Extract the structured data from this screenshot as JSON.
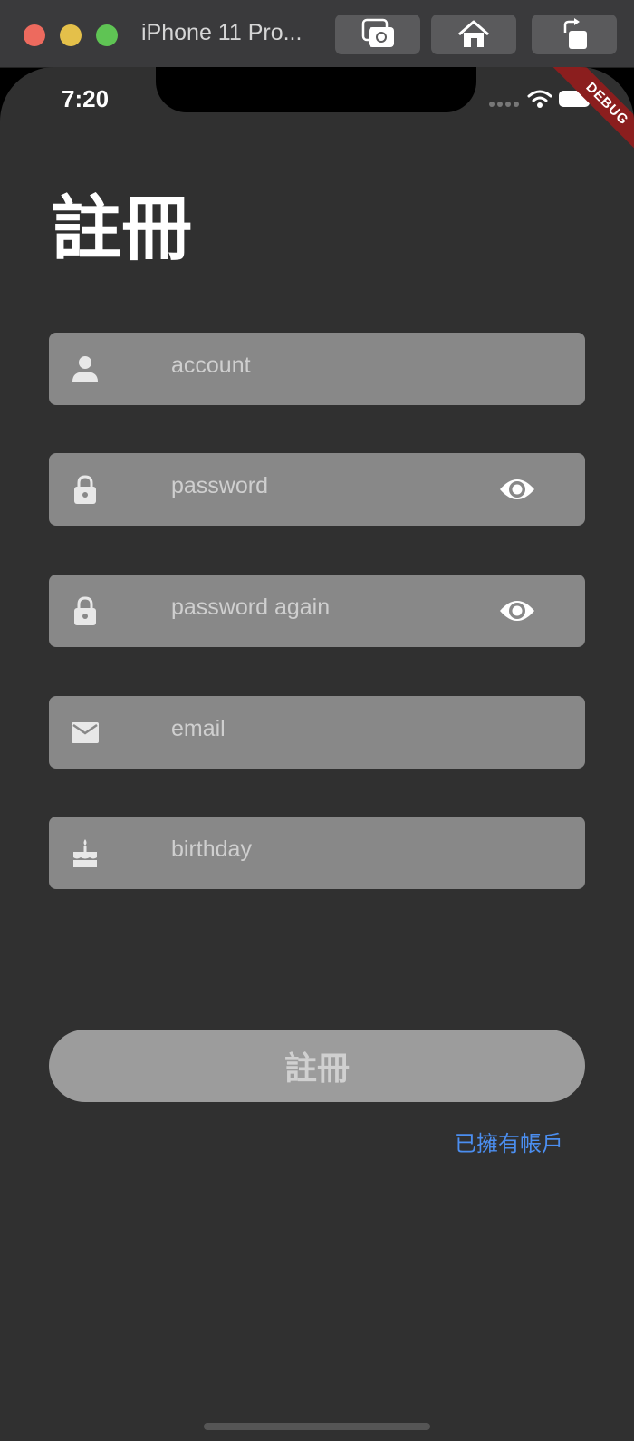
{
  "window": {
    "title": "iPhone 11 Pro..."
  },
  "status_bar": {
    "time": "7:20",
    "debug_label": "DEBUG"
  },
  "page": {
    "title": "註冊"
  },
  "fields": {
    "account": {
      "placeholder": "account",
      "icon": "person-icon"
    },
    "password": {
      "placeholder": "password",
      "icon": "lock-icon"
    },
    "password_again": {
      "placeholder": "password again",
      "icon": "lock-icon"
    },
    "email": {
      "placeholder": "email",
      "icon": "mail-icon"
    },
    "birthday": {
      "placeholder": "birthday",
      "icon": "cake-icon"
    }
  },
  "actions": {
    "submit_label": "註冊",
    "login_link": "已擁有帳戶"
  },
  "colors": {
    "background": "#303030",
    "field_background": "#888888",
    "button_background": "#9c9c9c",
    "link": "#4b8ef0",
    "debug_banner": "#8b1e1e"
  }
}
